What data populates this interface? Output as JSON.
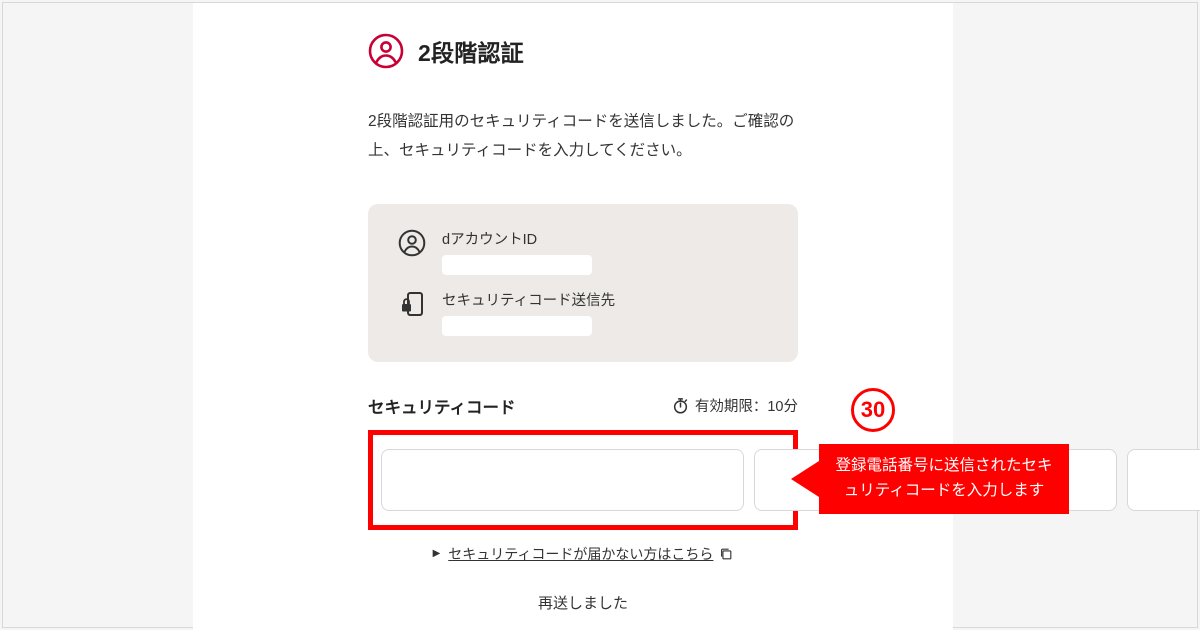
{
  "heading": {
    "title": "2段階認証"
  },
  "description": "2段階認証用のセキュリティコードを送信しました。ご確認の上、セキュリティコードを入力してください。",
  "info": {
    "account_id_label": "dアカウントID",
    "code_destination_label": "セキュリティコード送信先"
  },
  "code_section": {
    "label": "セキュリティコード",
    "expiry_text": "有効期限：10分"
  },
  "help_link_text": "セキュリティコードが届かない方はこちら",
  "resent_text": "再送しました",
  "annotation": {
    "step_number": "30",
    "callout_text": "登録電話番号に送信されたセキュリティコードを入力します"
  }
}
